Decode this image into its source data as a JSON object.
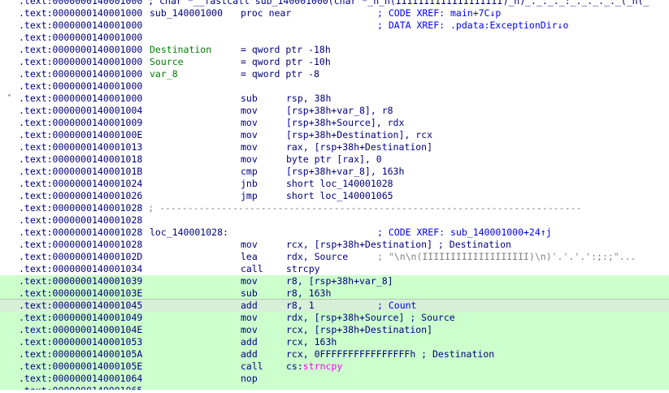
{
  "disasm": {
    "lines": [
      {
        "addr": ".text:0000000140001000",
        "text": " ; char *__fastcall sub_140001000(char *_n_n(IIIIIIIIIIIIIIIIIII)_n)_._._._:_._._._._(_n(_",
        "kind": "comment_full"
      },
      {
        "addr": ".text:0000000140001000",
        "label": "sub_140001000",
        "mnem": "proc near",
        "rcmt": "; CODE XREF: main+7C↓p"
      },
      {
        "addr": ".text:0000000140001000",
        "rcmt": "; DATA XREF: .pdata:ExceptionDir↓o"
      },
      {
        "addr": ".text:0000000140001000"
      },
      {
        "addr": ".text:0000000140001000",
        "label": "Destination",
        "mnem": "= qword ptr -18h"
      },
      {
        "addr": ".text:0000000140001000",
        "label": "Source",
        "mnem": "= qword ptr -10h"
      },
      {
        "addr": ".text:0000000140001000",
        "label": "var_8",
        "mnem": "= qword ptr -8"
      },
      {
        "addr": ".text:0000000140001000"
      },
      {
        "addr": ".text:0000000140001000",
        "mnem": "sub",
        "ops": "rsp, 38h",
        "arrow": "˅"
      },
      {
        "addr": ".text:0000000140001004",
        "mnem": "mov",
        "ops": "[rsp+38h+var_8], r8"
      },
      {
        "addr": ".text:0000000140001009",
        "mnem": "mov",
        "ops": "[rsp+38h+Source], rdx"
      },
      {
        "addr": ".text:000000014000100E",
        "mnem": "mov",
        "ops": "[rsp+38h+Destination], rcx"
      },
      {
        "addr": ".text:0000000140001013",
        "mnem": "mov",
        "ops": "rax, [rsp+38h+Destination]"
      },
      {
        "addr": ".text:0000000140001018",
        "mnem": "mov",
        "ops": "byte ptr [rax], 0"
      },
      {
        "addr": ".text:000000014000101B",
        "mnem": "cmp",
        "ops": "[rsp+38h+var_8], 163h"
      },
      {
        "addr": ".text:0000000140001024",
        "mnem": "jnb",
        "ops": "short loc_140001028"
      },
      {
        "addr": ".text:0000000140001026",
        "mnem": "jmp",
        "ops": "short loc_140001065"
      },
      {
        "addr": ".text:0000000140001028",
        "text": " ; ---------------------------------------------------------------------------",
        "kind": "separator"
      },
      {
        "addr": ".text:0000000140001028"
      },
      {
        "addr": ".text:0000000140001028",
        "label": "loc_140001028:",
        "rcmt": "; CODE XREF: sub_140001000+24↑j"
      },
      {
        "addr": ".text:0000000140001028",
        "mnem": "mov",
        "ops": "rcx, [rsp+38h+Destination] ; Destination"
      },
      {
        "addr": ".text:000000014000102D",
        "mnem": "lea",
        "ops": "rdx, Source",
        "grey": "; \"\\n\\n(IIIIIIIIIIIIIIIIIII)\\n)'.'.'.':;:;\"..."
      },
      {
        "addr": ".text:0000000140001034",
        "mnem": "call",
        "ops": "strcpy"
      },
      {
        "addr": ".text:0000000140001039",
        "mnem": "mov",
        "ops": "r8, [rsp+38h+var_8]",
        "hl": true
      },
      {
        "addr": ".text:000000014000103E",
        "mnem": "sub",
        "ops": "r8, 163h",
        "hl": true
      },
      {
        "addr": ".text:0000000140001045",
        "mnem": "add",
        "ops": "r8, 1",
        "trail": "; Count",
        "hl": true,
        "cur": true
      },
      {
        "addr": ".text:0000000140001049",
        "mnem": "mov",
        "ops": "rdx, [rsp+38h+Source] ; Source",
        "hl": true
      },
      {
        "addr": ".text:000000014000104E",
        "mnem": "mov",
        "ops": "rcx, [rsp+38h+Destination]",
        "hl": true
      },
      {
        "addr": ".text:0000000140001053",
        "mnem": "add",
        "ops": "rcx, 163h",
        "hl": true
      },
      {
        "addr": ".text:000000014000105A",
        "mnem": "add",
        "ops": "rcx, 0FFFFFFFFFFFFFFFFh ; Destination",
        "hl": true
      },
      {
        "addr": ".text:000000014000105E",
        "mnem": "call",
        "ops_prefix": "cs:",
        "ops_call": "strncpy",
        "hl": true
      },
      {
        "addr": ".text:0000000140001064",
        "mnem": "nop",
        "hl": true
      },
      {
        "addr": ".text:0000000140001065",
        "text": "",
        "kind": "partial",
        "hl": true
      }
    ]
  }
}
